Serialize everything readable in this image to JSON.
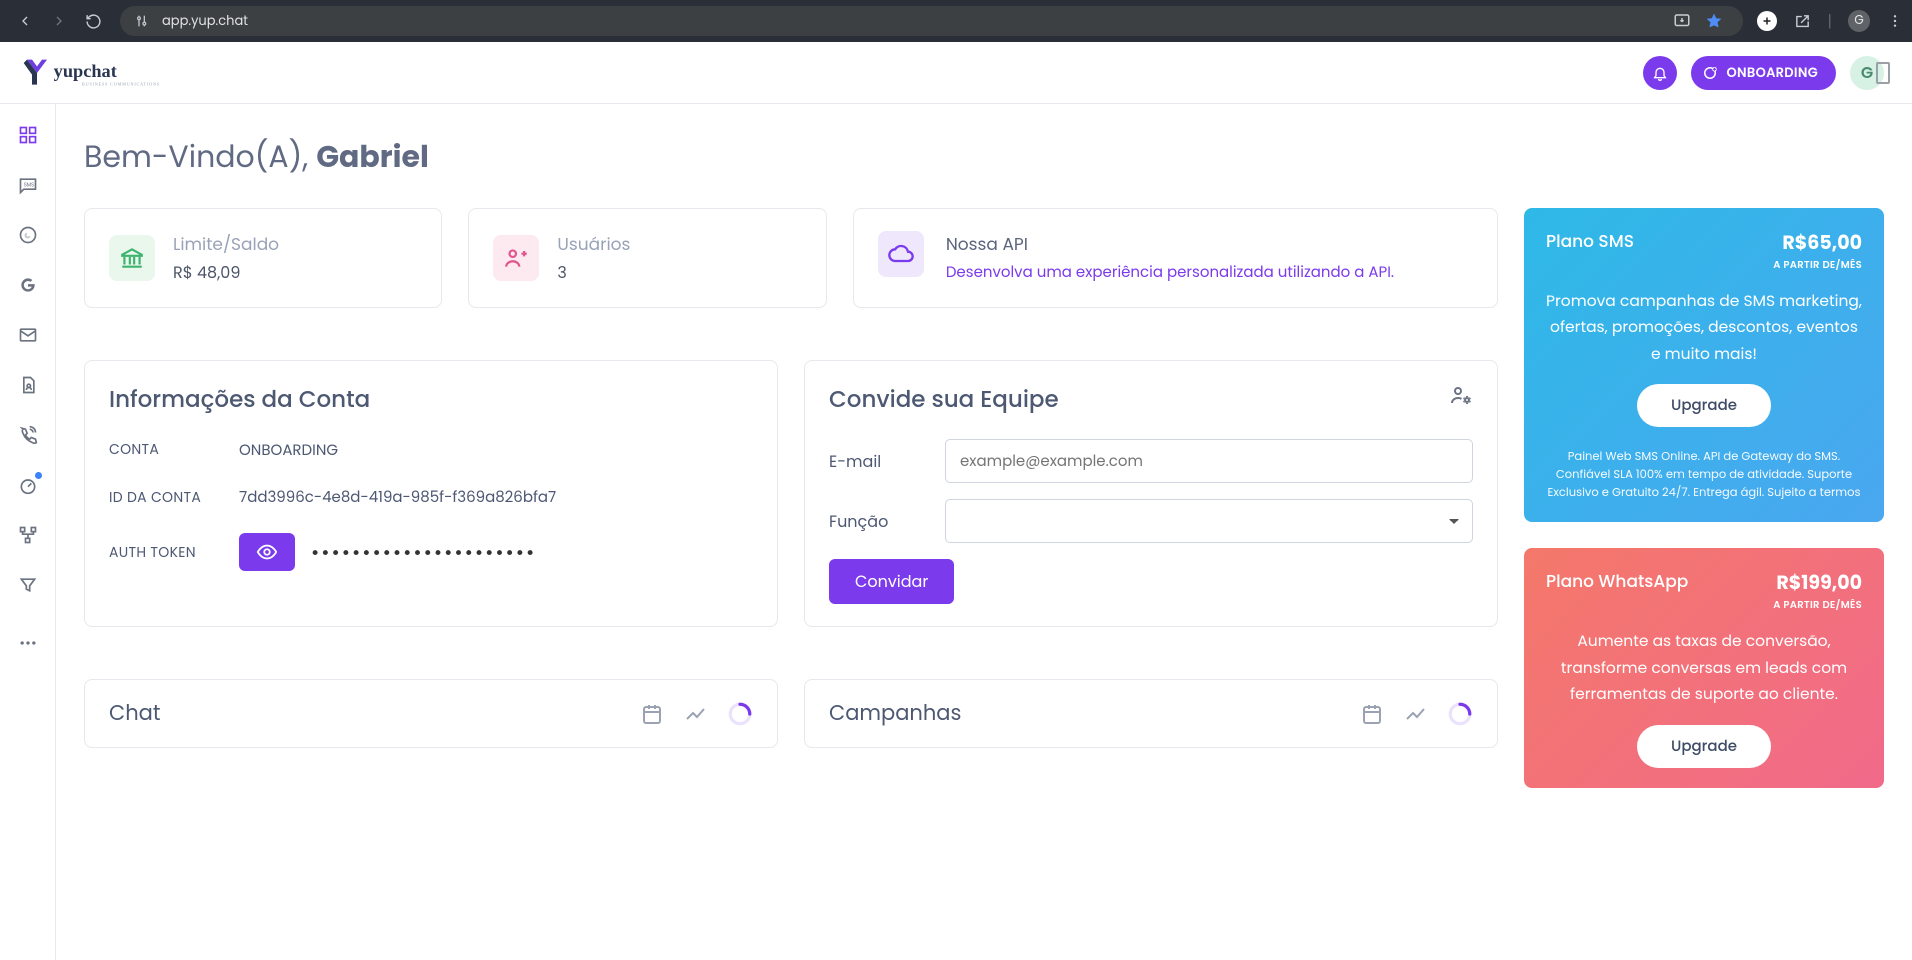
{
  "browser": {
    "url": "app.yup.chat",
    "profile_initial": "G"
  },
  "header": {
    "onboarding_label": "ONBOARDING",
    "avatar_initial": "G"
  },
  "welcome": {
    "greeting": "Bem-Vindo(A),",
    "name": "Gabriel"
  },
  "stats": {
    "balance": {
      "label": "Limite/Saldo",
      "value": "R$ 48,09"
    },
    "users": {
      "label": "Usuários",
      "value": "3"
    },
    "api": {
      "label": "Nossa API",
      "desc": "Desenvolva uma experiência personalizada utilizando a API."
    }
  },
  "account": {
    "title": "Informações da Conta",
    "rows": {
      "account": {
        "label": "CONTA",
        "value": "ONBOARDING"
      },
      "id": {
        "label": "ID DA CONTA",
        "value": "7dd3996c-4e8d-419a-985f-f369a826bfa7"
      },
      "token": {
        "label": "AUTH TOKEN",
        "masked": "••••••••••••••••••••••"
      }
    }
  },
  "invite": {
    "title": "Convide sua Equipe",
    "email_label": "E-mail",
    "email_placeholder": "example@example.com",
    "role_label": "Função",
    "button": "Convidar"
  },
  "mini": {
    "chat": "Chat",
    "campaigns": "Campanhas"
  },
  "promos": {
    "sms": {
      "title": "Plano SMS",
      "price": "R$65,00",
      "per": "A PARTIR DE/MÊS",
      "desc": "Promova campanhas de SMS marketing, ofertas, promoções, descontos, eventos e muito mais!",
      "cta": "Upgrade",
      "foot": "Painel Web SMS Online. API de Gateway do SMS. Confiável SLA 100% em tempo de atividade. Suporte Exclusivo e Gratuito 24/7. Entrega ágil. Sujeito a termos"
    },
    "wa": {
      "title": "Plano WhatsApp",
      "price": "R$199,00",
      "per": "A PARTIR DE/MÊS",
      "desc": "Aumente as taxas de conversão, transforme conversas em leads com ferramentas de suporte ao cliente.",
      "cta": "Upgrade"
    }
  }
}
